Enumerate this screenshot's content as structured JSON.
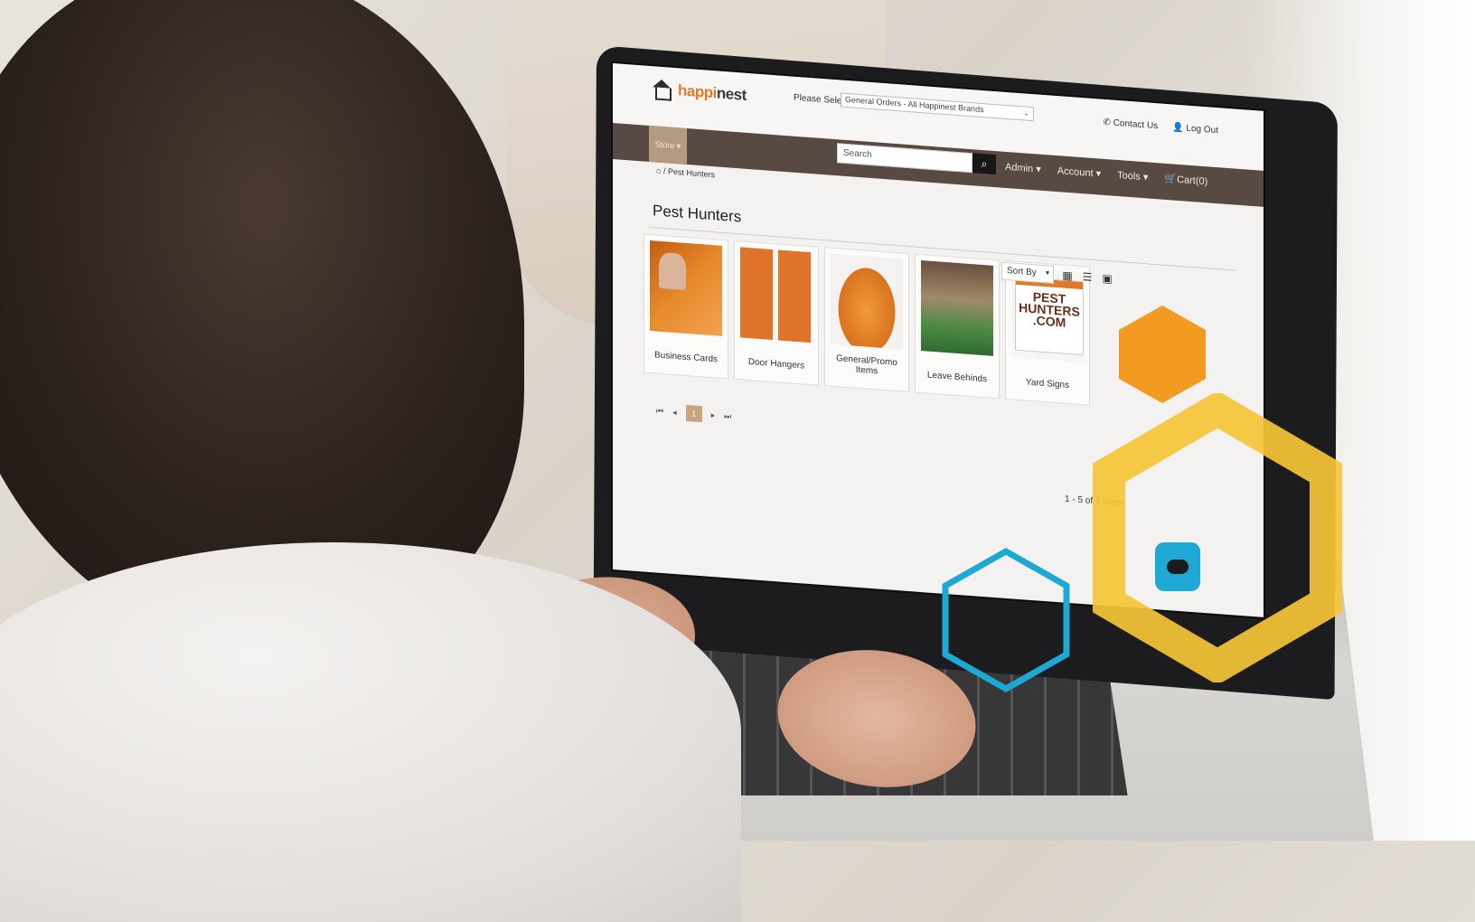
{
  "site": {
    "logo": {
      "brand_prefix": "happi",
      "brand_suffix": "nest"
    },
    "store_select": {
      "label": "Please Select",
      "value": "General Orders - All Happinest Brands"
    },
    "top_links": {
      "contact": "Contact Us",
      "logout": "Log Out"
    },
    "nav": {
      "store_label": "Store",
      "search_placeholder": "Search",
      "menu": [
        "Admin",
        "Account",
        "Tools",
        "Cart(0)"
      ]
    },
    "breadcrumb": "/ Pest Hunters",
    "page_title": "Pest Hunters",
    "sort": {
      "label": "Sort By"
    },
    "products": [
      {
        "label": "Business Cards"
      },
      {
        "label": "Door Hangers"
      },
      {
        "label": "General/Promo Items"
      },
      {
        "label": "Leave Behinds"
      },
      {
        "label": "Yard Signs"
      }
    ],
    "yard_sign_text": [
      "PEST",
      "HUNTERS",
      ".COM"
    ],
    "pagination": {
      "current": "1"
    },
    "items_count": "1 - 5 of 5 items"
  },
  "decor": {
    "hex_orange": "#f39a22",
    "hex_yellow": "#f5c636",
    "hex_blue": "#1ea9d4",
    "brand_brown": "#584943",
    "brand_orange": "#e07a2a"
  }
}
